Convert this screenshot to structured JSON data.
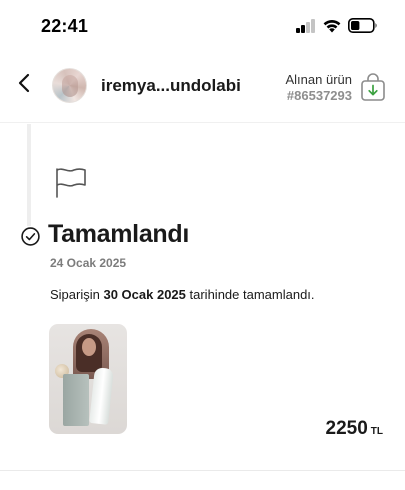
{
  "status_bar": {
    "time": "22:41",
    "signal_bars_filled": 2,
    "signal_bars_total": 4,
    "battery_level": 0.4
  },
  "header": {
    "back_icon": "chevron-left-icon",
    "seller_name": "iremya...undolabi",
    "order_type": "Alınan ürün",
    "order_number": "#86537293",
    "bag_icon": "shopping-bag-download-icon",
    "bag_accent_color": "#3aa13f"
  },
  "timeline": {
    "flag_icon": "flag-icon",
    "status_icon": "check-circle-icon",
    "status_title": "Tamamlandı",
    "status_date": "24 Ocak 2025",
    "description_prefix": "Siparişin",
    "description_date": "30 Ocak 2025",
    "description_suffix": "tarihinde tamamlandı."
  },
  "product": {
    "price": "2250",
    "currency": "TL"
  }
}
